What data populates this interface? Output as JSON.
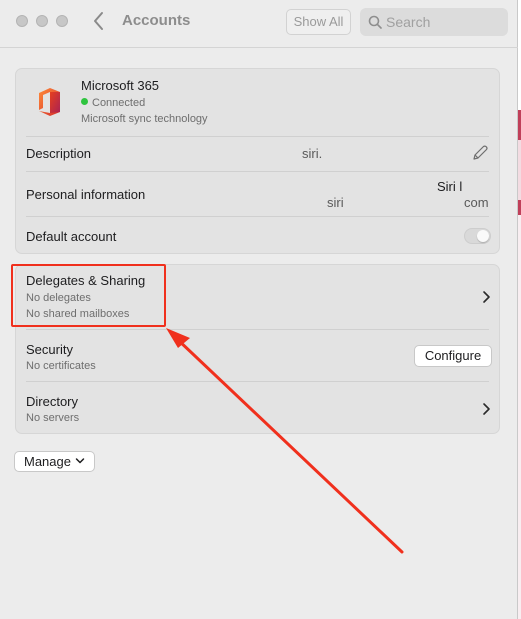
{
  "toolbar": {
    "title": "Accounts",
    "show_all_label": "Show All",
    "search_placeholder": "Search"
  },
  "account": {
    "name": "Microsoft 365",
    "status": "Connected",
    "subtitle": "Microsoft sync technology"
  },
  "account_rows": {
    "description_label": "Description",
    "description_value": "siri.",
    "personal_label": "Personal information",
    "personal_value_1": "Siri l",
    "personal_value_2": "siri",
    "personal_value_3": "com",
    "default_label": "Default account",
    "default_enabled": true
  },
  "settings_rows": [
    {
      "title": "Delegates & Sharing",
      "sub1": "No delegates",
      "sub2": "No shared mailboxes"
    },
    {
      "title": "Security",
      "sub1": "No certificates",
      "action_label": "Configure"
    },
    {
      "title": "Directory",
      "sub1": "No servers"
    }
  ],
  "manage_label": "Manage",
  "colors": {
    "annotation": "#f0301d",
    "status_green": "#2fc43f"
  }
}
